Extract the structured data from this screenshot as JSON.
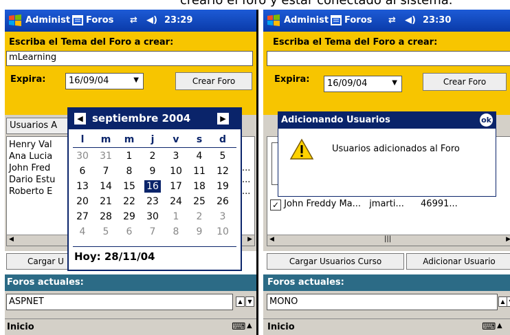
{
  "caption": "crearlo el foro y estar conectado al sistema.",
  "colors": {
    "title_bar": "#0a3aa8",
    "form_bg": "#f7c500",
    "section_bg": "#2c6b86",
    "selection": "#0a246a"
  },
  "left": {
    "title": "Administ",
    "app": "Foros",
    "time": "23:29",
    "topic_label": "Escriba el Tema del Foro a crear:",
    "topic_value": "mLearning",
    "expira_label": "Expira:",
    "expira_value": "16/09/04",
    "create_button": "Crear Foro",
    "tab_label": "Usuarios A",
    "rows": [
      "Henry Val",
      "Ana Lucia",
      "John Fred",
      "Dario Estu",
      "Roberto E"
    ],
    "ellipsis": "...",
    "load_button": "Cargar U",
    "calendar": {
      "month": "septiembre 2004",
      "weekdays": [
        "l",
        "m",
        "m",
        "j",
        "v",
        "s",
        "d"
      ],
      "weeks": [
        [
          "30",
          "31",
          "1",
          "2",
          "3",
          "4",
          "5"
        ],
        [
          "6",
          "7",
          "8",
          "9",
          "10",
          "11",
          "12"
        ],
        [
          "13",
          "14",
          "15",
          "16",
          "17",
          "18",
          "19"
        ],
        [
          "20",
          "21",
          "22",
          "23",
          "24",
          "25",
          "26"
        ],
        [
          "27",
          "28",
          "29",
          "30",
          "1",
          "2",
          "3"
        ],
        [
          "4",
          "5",
          "6",
          "7",
          "8",
          "9",
          "10"
        ]
      ],
      "selected": "16",
      "today": "Hoy: 28/11/04"
    },
    "forums_label": "Foros actuales:",
    "forum_value": "ASPNET",
    "start": "Inicio"
  },
  "right": {
    "title": "Administ",
    "app": "Foros",
    "time": "23:30",
    "topic_label": "Escriba el Tema del Foro a crear:",
    "topic_value": "",
    "expira_label": "Expira:",
    "expira_value": "16/09/04",
    "create_button": "Crear Foro",
    "dialog_title": "Adicionando Usuarios",
    "ok_label": "ok",
    "dialog_message": "Usuarios adicionados al Foro",
    "row_name": "John Freddy Ma...",
    "row_login": "jmarti...",
    "row_id": "46991...",
    "load_button": "Cargar Usuarios Curso",
    "add_button": "Adicionar Usuario",
    "forums_label": "Foros actuales:",
    "forum_value": "MONO",
    "start": "Inicio"
  }
}
